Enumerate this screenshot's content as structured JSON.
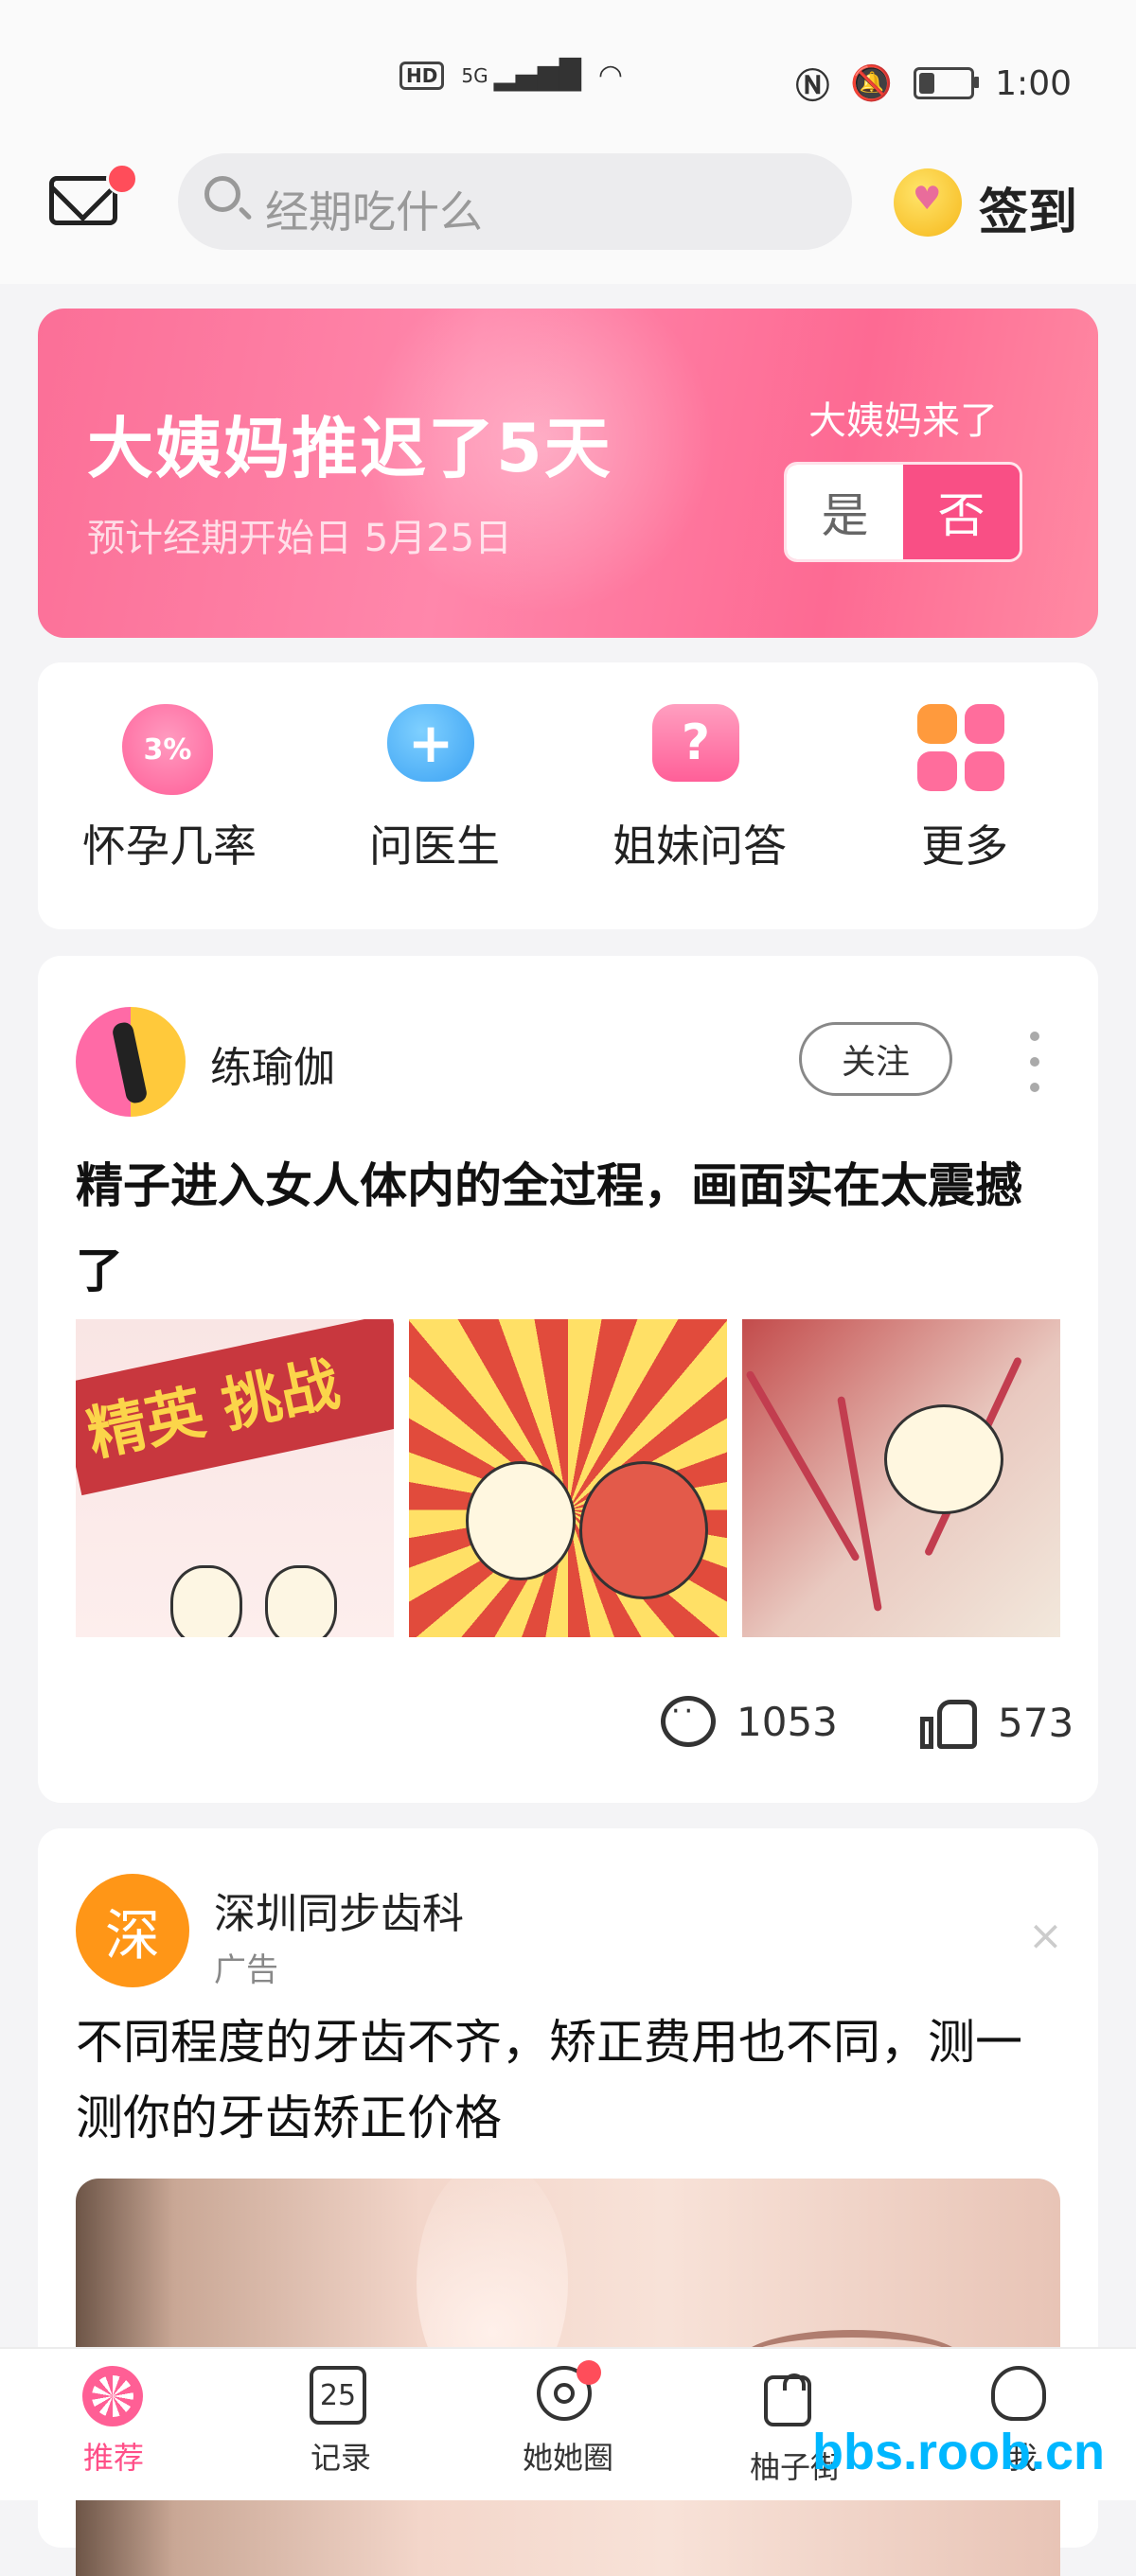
{
  "status_bar": {
    "network": "5G",
    "hd_badge": "HD",
    "time": "1:00"
  },
  "header": {
    "search_placeholder": "经期吃什么",
    "signin_label": "签到"
  },
  "period_banner": {
    "title": "大姨妈推迟了5天",
    "subtitle": "预计经期开始日 5月25日",
    "question": "大姨妈来了",
    "yes_label": "是",
    "no_label": "否"
  },
  "quick_actions": [
    {
      "label": "怀孕几率",
      "icon": "pregnancy-chance-icon",
      "badge": "3%"
    },
    {
      "label": "问医生",
      "icon": "ask-doctor-icon",
      "badge": "+"
    },
    {
      "label": "姐妹问答",
      "icon": "sister-qa-icon",
      "badge": "?"
    },
    {
      "label": "更多",
      "icon": "more-grid-icon"
    }
  ],
  "post": {
    "author": "练瑜伽",
    "follow_label": "关注",
    "title": "精子进入女人体内的全过程，画面实在太震撼了",
    "images": [
      "精英 挑战",
      "",
      ""
    ],
    "comments": "1053",
    "likes": "573"
  },
  "ad": {
    "avatar_char": "深",
    "advertiser": "深圳同步齿科",
    "tag": "广告",
    "close_label": "×",
    "title": "不同程度的牙齿不齐，矫正费用也不同，测一测你的牙齿矫正价格"
  },
  "tabbar": {
    "tabs": [
      {
        "label": "推荐",
        "active": true
      },
      {
        "label": "记录",
        "icon_text": "25"
      },
      {
        "label": "她她圈"
      },
      {
        "label": "柚子街"
      },
      {
        "label": "我"
      }
    ]
  },
  "watermark": "bbs.roob.cn",
  "colors": {
    "accent": "#ff4f88",
    "banner_start": "#fb6f97",
    "ad_avatar": "#ff9617"
  }
}
